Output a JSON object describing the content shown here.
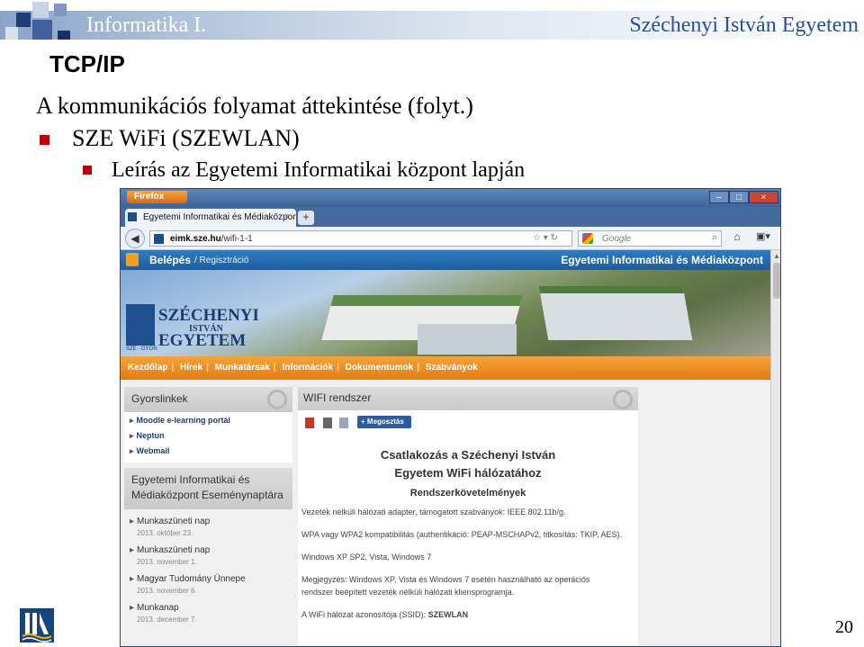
{
  "slide": {
    "course_title": "Informatika I.",
    "university": "Széchenyi István Egyetem",
    "section_title": "TCP/IP",
    "line1": "A kommunikációs folyamat áttekintése (folyt.)",
    "line2": "SZE WiFi (SZEWLAN)",
    "line3": "Leírás az Egyetemi Informatikai központ lapján",
    "page_number": "20",
    "bullet_color": "#c00000"
  },
  "browser": {
    "app_button": "Firefox",
    "tab_title": "Egyetemi Informatikai és Médiaközpont ...",
    "tab_close": "×",
    "new_tab": "+",
    "url_host": "eimk.sze.hu",
    "url_path": "/wifi-1-1",
    "search_placeholder": "Google",
    "min_label": "–",
    "max_label": "□",
    "close_label": "×"
  },
  "site": {
    "login": "Belépés",
    "register": "/ Regisztráció",
    "site_name": "Egyetemi Informatikai és Médiaközpont",
    "logo_line1": "SZÉCHENYI",
    "logo_line2": "ISTVÁN",
    "logo_line3": "EGYETEM",
    "logo_sub": "SZE · GYŐR",
    "menu": [
      "Kezdőlap",
      "Hírek",
      "Munkatársak",
      "Információk",
      "Dokumentumok",
      "Szabványok"
    ],
    "quicklinks_title": "Gyorslinkek",
    "quicklinks": [
      "Moodle e-learning portál",
      "Neptun",
      "Webmail"
    ],
    "events_title_1": "Egyetemi Informatikai és",
    "events_title_2": "Médiaközpont Eseménynaptára",
    "events": [
      {
        "title": "Munkaszüneti nap",
        "date": "2013. október 23."
      },
      {
        "title": "Munkaszüneti nap",
        "date": "2013. november 1."
      },
      {
        "title": "Magyar Tudomány Ünnepe",
        "date": "2013. november 6."
      },
      {
        "title": "Munkanap",
        "date": "2013. december 7."
      }
    ],
    "main_title": "WIFI rendszer",
    "share_label": "Megosztás",
    "content_title_1": "Csatlakozás a Széchenyi István",
    "content_title_2": "Egyetem WiFi hálózatához",
    "requirements_heading": "Rendszerkövetelmények",
    "req1": "Vezeték nélküli hálózati adapter, támogatott szabványok: IEEE 802.11b/g.",
    "req2": "WPA vagy WPA2 kompatibilitás (authentikáció: PEAP-MSCHAPv2, titkosítás: TKIP, AES).",
    "req3": "Windows XP SP2, Vista, Windows 7",
    "note1": "Megjegyzés: Windows XP, Vista és Windows 7 esetén használható az operációs",
    "note2": "rendszer beépített vezeték nélküli hálózati kliensprogramja.",
    "ssid_label": "A WiFi hálózat azonosítója (SSID):",
    "ssid_value": "SZEWLAN"
  }
}
